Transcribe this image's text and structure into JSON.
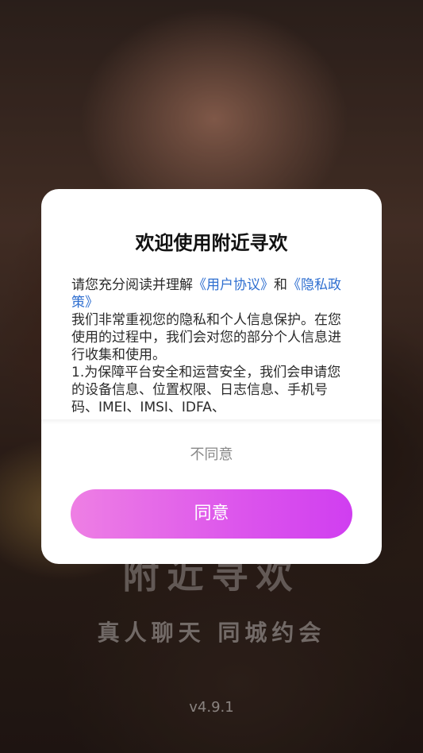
{
  "splash": {
    "app_name": "附近寻欢",
    "slogan": "真人聊天 同城约会",
    "version": "v4.9.1"
  },
  "dialog": {
    "title": "欢迎使用附近寻欢",
    "intro_prefix": "请您充分阅读并理解",
    "user_agreement_link": "《用户协议》",
    "and": "和",
    "privacy_policy_link": "《隐私政策》",
    "paragraph_1": "我们非常重视您的隐私和个人信息保护。在您使用的过程中，我们会对您的部分个人信息进行收集和使用。",
    "paragraph_2": " 1.为保障平台安全和运营安全，我们会申请您的设备信息、位置权限、日志信息、手机号码、IMEI、IMSI、IDFA、",
    "disagree_label": "不同意",
    "agree_label": "同意"
  },
  "colors": {
    "link": "#2f6fd0",
    "agree_gradient_start": "#ee7fe4",
    "agree_gradient_end": "#d03ef0"
  }
}
